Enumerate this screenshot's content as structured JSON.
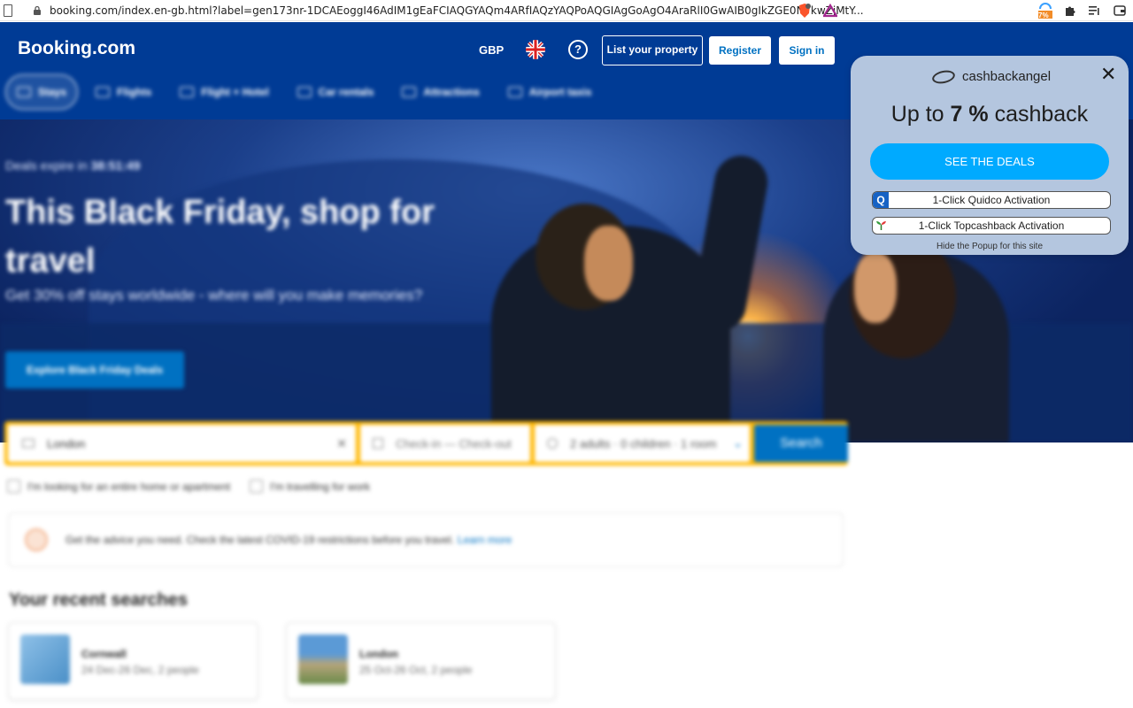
{
  "browser": {
    "url": "booking.com/index.en-gb.html?label=gen173nr-1DCAEoggI46AdIM1gEaFCIAQGYAQm4ARfIAQzYAQPoAQGIAgGoAgO4AraRlI0GwAIB0gIkZGE0NTkwZjMtY...",
    "ext_badge": "7%"
  },
  "header": {
    "logo": "Booking.com",
    "currency": "GBP",
    "help_label": "?",
    "list_property": "List your property",
    "register": "Register",
    "sign_in": "Sign in"
  },
  "nav": {
    "items": [
      {
        "label": "Stays"
      },
      {
        "label": "Flights"
      },
      {
        "label": "Flight + Hotel"
      },
      {
        "label": "Car rentals"
      },
      {
        "label": "Attractions"
      },
      {
        "label": "Airport taxis"
      }
    ]
  },
  "hero": {
    "timer_prefix": "Deals expire in",
    "timer": "38:51:49",
    "title": "This Black Friday, shop for travel",
    "subtitle": "Get 30% off stays worldwide - where will you make memories?",
    "cta": "Explore Black Friday Deals"
  },
  "search": {
    "destination": "London",
    "dates": "Check-in — Check-out",
    "guests": "2 adults · 0 children · 1 room",
    "button": "Search",
    "check_apartment": "I'm looking for an entire home or apartment",
    "check_work": "I'm travelling for work"
  },
  "covid": {
    "text": "Get the advice you need. Check the latest COVID-19 restrictions before you travel.",
    "link": "Learn more"
  },
  "recent": {
    "title": "Your recent searches",
    "cards": [
      {
        "name": "Cornwall",
        "details": "24 Dec-26 Dec, 2 people"
      },
      {
        "name": "London",
        "details": "25 Oct-26 Oct, 2 people"
      }
    ]
  },
  "popup": {
    "brand": "cashbackangel",
    "headline_pre": "Up to",
    "headline_value": "7 %",
    "headline_post": "cashback",
    "deals_button": "SEE THE DEALS",
    "quidco_badge": "Q",
    "quidco": "1-Click Quidco Activation",
    "topcashback": "1-Click Topcashback Activation",
    "hide": "Hide the Popup for this site",
    "close": "✕"
  },
  "colors": {
    "brand_blue": "#003b95",
    "action_blue": "#0071c2",
    "search_yellow": "#ffb700",
    "popup_bg": "#b4c6df",
    "popup_button": "#00aaff"
  }
}
